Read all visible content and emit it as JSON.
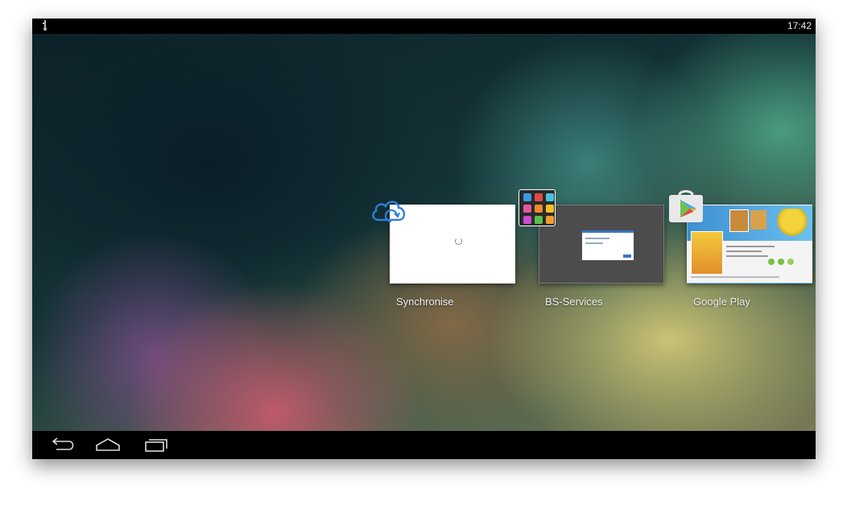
{
  "status_bar": {
    "time": "17:42",
    "icon": "usb-debug-icon"
  },
  "recents": [
    {
      "label": "Synchronise",
      "icon": "cloud-sync-icon"
    },
    {
      "label": "BS-Services",
      "icon": "app-grid-icon"
    },
    {
      "label": "Google Play",
      "icon": "google-play-icon"
    }
  ],
  "nav_bar": {
    "back_icon": "back-icon",
    "home_icon": "home-icon",
    "recents_icon": "recents-icon"
  },
  "colors": {
    "cloud_blue": "#2f80d8",
    "play_blue": "#4aa8e8"
  }
}
